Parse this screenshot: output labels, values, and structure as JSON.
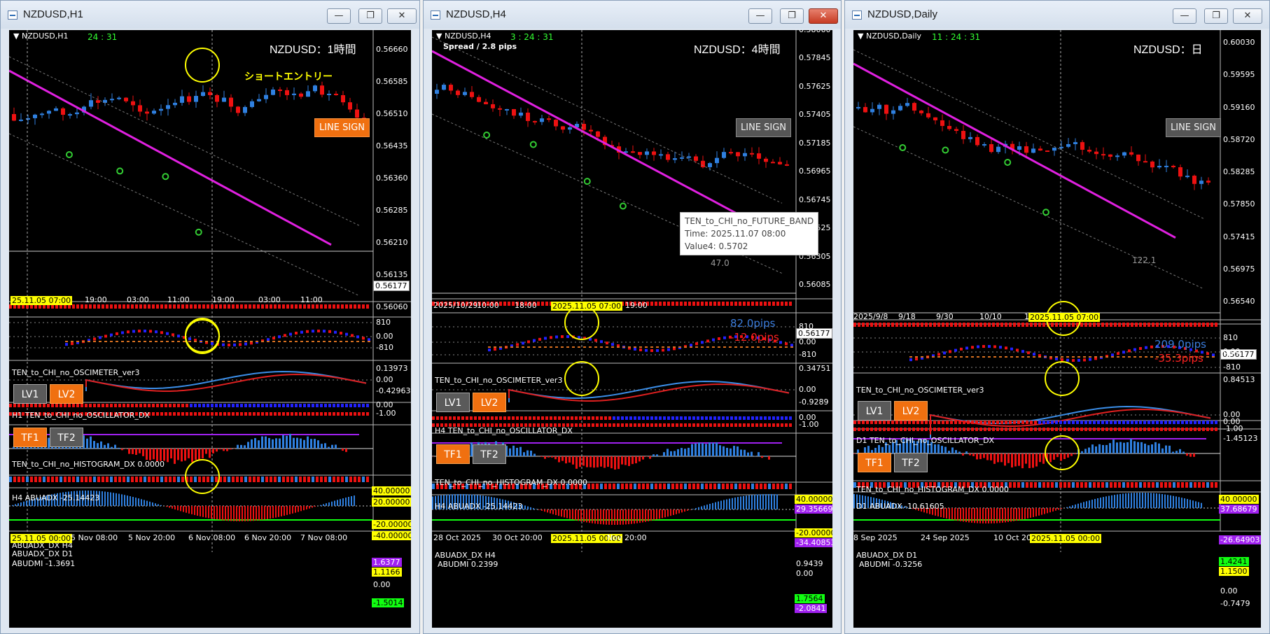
{
  "windows": [
    {
      "title": "NZDUSD,H1",
      "chart_header": "NZDUSD,H1",
      "timer": "24 : 31",
      "timeframe_label": "NZDUSD：1時間",
      "annotation": "ショートエントリー",
      "line_sign": "LINE SIGN",
      "price_axis": [
        "0.56660",
        "0.56585",
        "0.56510",
        "0.56435",
        "0.56360",
        "0.56285",
        "0.56210",
        "0.56135",
        "0.56060"
      ],
      "current_price": "0.56177",
      "time_axis": [
        "25.11.05 07:00",
        "19:00",
        "03:00",
        "11:00",
        "19:00",
        "03:00",
        "11:00"
      ],
      "osc_title": "TEN_to_CHI_no_OSCIMETER_ver3",
      "osc_axis": [
        "810",
        "0.00",
        "-810"
      ],
      "buttons_lv": [
        "LV1",
        "LV2"
      ],
      "oscillator_title": "H1 TEN_to_CHI_no_OSCILLATOR_DX",
      "oscillator_axis": [
        "0.13973",
        "0.00",
        "-0.42963"
      ],
      "buttons_tf": [
        "TF1",
        "TF2"
      ],
      "histogram_title": "TEN_to_CHI_no_HISTOGRAM_DX 0.0000",
      "histogram_axis": [
        "0.00",
        "-1.00"
      ],
      "abuadx_title": "H4 ABUADX -25.14423",
      "abuadx_tags": [
        "40.00000",
        "20.00000",
        "-20.00000",
        "-40.00000"
      ],
      "abuadx_dx": [
        "ABUADX_DX H4",
        "ABUADX_DX D1"
      ],
      "abudmi_title": "ABUDMI -1.3691",
      "abudmi_tags": [
        "1.6377",
        "1.1166",
        "0.00",
        "-1.5014"
      ],
      "bottom_axis": [
        "25.11.05 00:00",
        "5 Nov 08:00",
        "5 Nov 20:00",
        "6 Nov 08:00",
        "6 Nov 20:00",
        "7 Nov 08:00"
      ]
    },
    {
      "title": "NZDUSD,H4",
      "chart_header": "NZDUSD,H4",
      "timer": "3 : 24 : 31",
      "spread": "Spread / 2.8 pips",
      "timeframe_label": "NZDUSD：4時間",
      "line_sign": "LINE SIGN",
      "price_axis": [
        "0.58060",
        "0.57845",
        "0.57625",
        "0.57405",
        "0.57185",
        "0.56965",
        "0.56745",
        "0.56525",
        "0.56305",
        "0.56085"
      ],
      "current_price": "0.56177",
      "pips_up": "82.0pips",
      "pips_down": "-12.0pips",
      "band_value": "47.0",
      "tooltip": [
        "TEN_to_CHI_no_FUTURE_BAND",
        "Time: 2025.11.07 08:00",
        "Value4: 0.5702"
      ],
      "time_axis": [
        "2025/10/29",
        "10:00",
        "18:00",
        "2025.11.05 07:00",
        "19:00"
      ],
      "osc_title": "TEN_to_CHI_no_OSCIMETER_ver3",
      "osc_axis": [
        "810",
        "0.00",
        "-810"
      ],
      "buttons_lv": [
        "LV1",
        "LV2"
      ],
      "oscillator_title": "H4 TEN_to_CHI_no_OSCILLATOR_DX",
      "oscillator_axis": [
        "0.34751",
        "0.00",
        "-0.9289"
      ],
      "buttons_tf": [
        "TF1",
        "TF2"
      ],
      "histogram_title": "TEN_to_CHI_no_HISTOGRAM_DX 0.0000",
      "histogram_axis": [
        "0.00",
        "-1.00"
      ],
      "abuadx_title": "H4 ABUADX -25.14423",
      "abuadx_tags": [
        "40.00000",
        "29.35669",
        "-20.00000",
        "-34.40853"
      ],
      "abuadx_dx": [
        "ABUADX_DX H4"
      ],
      "abudmi_title": "ABUDMI 0.2399",
      "abudmi_tags": [
        "0.9439",
        "0.00",
        "1.7564",
        "-2.0841"
      ],
      "bottom_axis": [
        "28 Oct 2025",
        "30 Oct 20:00",
        "2025.11.05 00:00",
        "Nov 20:00"
      ]
    },
    {
      "title": "NZDUSD,Daily",
      "chart_header": "NZDUSD,Daily",
      "timer": "11 : 24 : 31",
      "timeframe_label": "NZDUSD：日",
      "line_sign": "LINE SIGN",
      "price_axis": [
        "0.60030",
        "0.59595",
        "0.59160",
        "0.58720",
        "0.58285",
        "0.57850",
        "0.57415",
        "0.56975",
        "0.56540"
      ],
      "current_price": "0.56177",
      "pips_up": "209.0pips",
      "pips_down": "-35.3pips",
      "band_value": "122.1",
      "time_axis": [
        "2025/9/8",
        "9/18",
        "9/30",
        "10/10",
        "10/22",
        "2025.11.05 07:00"
      ],
      "osc_title": "TEN_to_CHI_no_OSCIMETER_ver3",
      "osc_axis": [
        "810",
        "0.00",
        "-810"
      ],
      "buttons_lv": [
        "LV1",
        "LV2"
      ],
      "oscillator_title": "D1 TEN_to_CHI_no_OSCILLATOR_DX",
      "oscillator_axis": [
        "0.84513",
        "0.00",
        "-1.45123"
      ],
      "buttons_tf": [
        "TF1",
        "TF2"
      ],
      "histogram_title": "TEN_to_CHI_no_HISTOGRAM_DX 0.0000",
      "histogram_axis": [
        "0.00",
        "-1.00"
      ],
      "abuadx_title": "D1 ABUADX -10.61605",
      "abuadx_tags": [
        "40.00000",
        "37.68679",
        "-26.64903"
      ],
      "abuadx_dx": [
        "ABUADX_DX D1"
      ],
      "abudmi_title": "ABUDMI -0.3256",
      "abudmi_tags": [
        "1.4241",
        "1.1500",
        "0.00",
        "-0.7479"
      ],
      "bottom_axis": [
        "8 Sep 2025",
        "24 Sep 2025",
        "10 Oct 2025",
        "2025.11.05 00:00"
      ]
    }
  ],
  "colors": {
    "bull": "#2f80e0",
    "bear": "#ee1111",
    "ma": "#e020e0",
    "highlight": "#ffff00",
    "signal": "#33cc33"
  },
  "icons": [
    "window-icon",
    "minimize-icon",
    "maximize-icon",
    "close-icon"
  ]
}
